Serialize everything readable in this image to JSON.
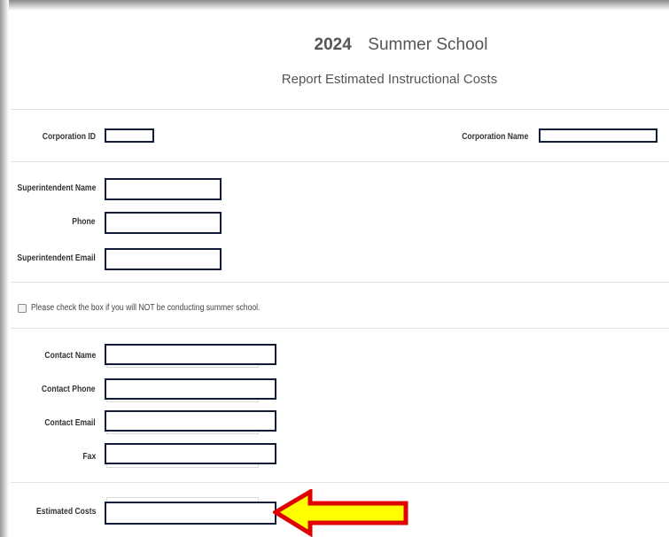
{
  "header": {
    "year": "2024",
    "title": "Summer School",
    "subtitle": "Report Estimated Instructional Costs"
  },
  "corporation": {
    "id_label": "Corporation ID",
    "id_value": "",
    "name_label": "Corporation Name",
    "name_value": ""
  },
  "superintendent": {
    "name_label": "Superintendent Name",
    "name_value": "",
    "phone_label": "Phone",
    "phone_value": "",
    "email_label": "Superintendent Email",
    "email_value": ""
  },
  "no_summer_school": {
    "label": "Please check the box if you will NOT be conducting summer school.",
    "checked": false
  },
  "contact": {
    "name_label": "Contact Name",
    "name_value": "",
    "phone_label": "Contact Phone",
    "phone_value": "",
    "email_label": "Contact Email",
    "email_value": "",
    "fax_label": "Fax",
    "fax_value": ""
  },
  "costs": {
    "label": "Estimated Costs",
    "value": ""
  },
  "colors": {
    "field_border": "#111b3a",
    "arrow_fill": "#ffff00",
    "arrow_stroke": "#e00000",
    "text": "#555555"
  },
  "icons": {
    "arrow": "left-arrow-icon"
  }
}
